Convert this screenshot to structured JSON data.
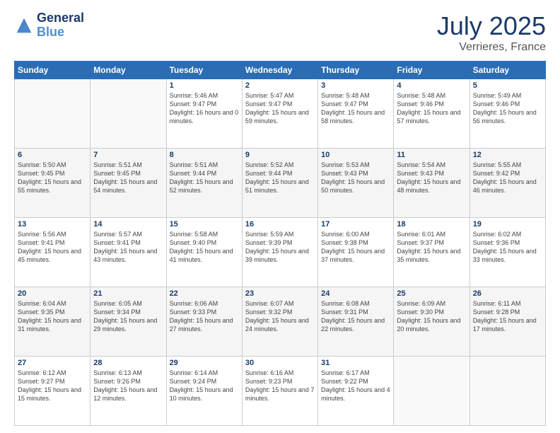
{
  "header": {
    "logo_line1": "General",
    "logo_line2": "Blue",
    "month": "July 2025",
    "location": "Verrieres, France"
  },
  "days_of_week": [
    "Sunday",
    "Monday",
    "Tuesday",
    "Wednesday",
    "Thursday",
    "Friday",
    "Saturday"
  ],
  "weeks": [
    [
      {
        "day": "",
        "info": ""
      },
      {
        "day": "",
        "info": ""
      },
      {
        "day": "1",
        "info": "Sunrise: 5:46 AM\nSunset: 9:47 PM\nDaylight: 16 hours\nand 0 minutes."
      },
      {
        "day": "2",
        "info": "Sunrise: 5:47 AM\nSunset: 9:47 PM\nDaylight: 15 hours\nand 59 minutes."
      },
      {
        "day": "3",
        "info": "Sunrise: 5:48 AM\nSunset: 9:47 PM\nDaylight: 15 hours\nand 58 minutes."
      },
      {
        "day": "4",
        "info": "Sunrise: 5:48 AM\nSunset: 9:46 PM\nDaylight: 15 hours\nand 57 minutes."
      },
      {
        "day": "5",
        "info": "Sunrise: 5:49 AM\nSunset: 9:46 PM\nDaylight: 15 hours\nand 56 minutes."
      }
    ],
    [
      {
        "day": "6",
        "info": "Sunrise: 5:50 AM\nSunset: 9:45 PM\nDaylight: 15 hours\nand 55 minutes."
      },
      {
        "day": "7",
        "info": "Sunrise: 5:51 AM\nSunset: 9:45 PM\nDaylight: 15 hours\nand 54 minutes."
      },
      {
        "day": "8",
        "info": "Sunrise: 5:51 AM\nSunset: 9:44 PM\nDaylight: 15 hours\nand 52 minutes."
      },
      {
        "day": "9",
        "info": "Sunrise: 5:52 AM\nSunset: 9:44 PM\nDaylight: 15 hours\nand 51 minutes."
      },
      {
        "day": "10",
        "info": "Sunrise: 5:53 AM\nSunset: 9:43 PM\nDaylight: 15 hours\nand 50 minutes."
      },
      {
        "day": "11",
        "info": "Sunrise: 5:54 AM\nSunset: 9:43 PM\nDaylight: 15 hours\nand 48 minutes."
      },
      {
        "day": "12",
        "info": "Sunrise: 5:55 AM\nSunset: 9:42 PM\nDaylight: 15 hours\nand 46 minutes."
      }
    ],
    [
      {
        "day": "13",
        "info": "Sunrise: 5:56 AM\nSunset: 9:41 PM\nDaylight: 15 hours\nand 45 minutes."
      },
      {
        "day": "14",
        "info": "Sunrise: 5:57 AM\nSunset: 9:41 PM\nDaylight: 15 hours\nand 43 minutes."
      },
      {
        "day": "15",
        "info": "Sunrise: 5:58 AM\nSunset: 9:40 PM\nDaylight: 15 hours\nand 41 minutes."
      },
      {
        "day": "16",
        "info": "Sunrise: 5:59 AM\nSunset: 9:39 PM\nDaylight: 15 hours\nand 39 minutes."
      },
      {
        "day": "17",
        "info": "Sunrise: 6:00 AM\nSunset: 9:38 PM\nDaylight: 15 hours\nand 37 minutes."
      },
      {
        "day": "18",
        "info": "Sunrise: 6:01 AM\nSunset: 9:37 PM\nDaylight: 15 hours\nand 35 minutes."
      },
      {
        "day": "19",
        "info": "Sunrise: 6:02 AM\nSunset: 9:36 PM\nDaylight: 15 hours\nand 33 minutes."
      }
    ],
    [
      {
        "day": "20",
        "info": "Sunrise: 6:04 AM\nSunset: 9:35 PM\nDaylight: 15 hours\nand 31 minutes."
      },
      {
        "day": "21",
        "info": "Sunrise: 6:05 AM\nSunset: 9:34 PM\nDaylight: 15 hours\nand 29 minutes."
      },
      {
        "day": "22",
        "info": "Sunrise: 6:06 AM\nSunset: 9:33 PM\nDaylight: 15 hours\nand 27 minutes."
      },
      {
        "day": "23",
        "info": "Sunrise: 6:07 AM\nSunset: 9:32 PM\nDaylight: 15 hours\nand 24 minutes."
      },
      {
        "day": "24",
        "info": "Sunrise: 6:08 AM\nSunset: 9:31 PM\nDaylight: 15 hours\nand 22 minutes."
      },
      {
        "day": "25",
        "info": "Sunrise: 6:09 AM\nSunset: 9:30 PM\nDaylight: 15 hours\nand 20 minutes."
      },
      {
        "day": "26",
        "info": "Sunrise: 6:11 AM\nSunset: 9:28 PM\nDaylight: 15 hours\nand 17 minutes."
      }
    ],
    [
      {
        "day": "27",
        "info": "Sunrise: 6:12 AM\nSunset: 9:27 PM\nDaylight: 15 hours\nand 15 minutes."
      },
      {
        "day": "28",
        "info": "Sunrise: 6:13 AM\nSunset: 9:26 PM\nDaylight: 15 hours\nand 12 minutes."
      },
      {
        "day": "29",
        "info": "Sunrise: 6:14 AM\nSunset: 9:24 PM\nDaylight: 15 hours\nand 10 minutes."
      },
      {
        "day": "30",
        "info": "Sunrise: 6:16 AM\nSunset: 9:23 PM\nDaylight: 15 hours\nand 7 minutes."
      },
      {
        "day": "31",
        "info": "Sunrise: 6:17 AM\nSunset: 9:22 PM\nDaylight: 15 hours\nand 4 minutes."
      },
      {
        "day": "",
        "info": ""
      },
      {
        "day": "",
        "info": ""
      }
    ]
  ]
}
